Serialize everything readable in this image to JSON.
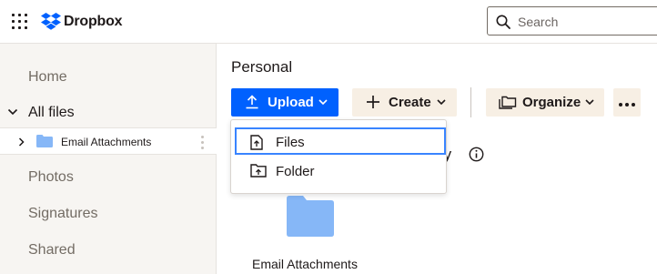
{
  "app": {
    "brand_name": "Dropbox",
    "brand_color": "#0061fe"
  },
  "header": {
    "apps_icon": "grid-icon",
    "search_placeholder": "Search",
    "search_icon": "search-icon"
  },
  "sidebar": {
    "items": [
      {
        "label": "Home"
      },
      {
        "label": "All files"
      },
      {
        "label": "Photos"
      },
      {
        "label": "Signatures"
      },
      {
        "label": "Shared"
      }
    ],
    "tree": {
      "selected_folder": "Email Attachments"
    }
  },
  "main": {
    "breadcrumb": "Personal",
    "toolbar": {
      "upload_label": "Upload",
      "create_label": "Create",
      "organize_label": "Organize"
    },
    "partial_heading_suffix": "ry",
    "folders": [
      {
        "name": "Email Attachments"
      }
    ]
  },
  "upload_menu": {
    "items": [
      {
        "label": "Files",
        "icon": "file-upload-icon",
        "focused": true
      },
      {
        "label": "Folder",
        "icon": "folder-upload-icon",
        "focused": false
      }
    ]
  },
  "colors": {
    "primary": "#0061fe",
    "secondary_button": "#f7efe4",
    "sidebar_bg": "#f7f5f2",
    "focus_ring": "#3984ff",
    "folder": "#86b7f7"
  }
}
